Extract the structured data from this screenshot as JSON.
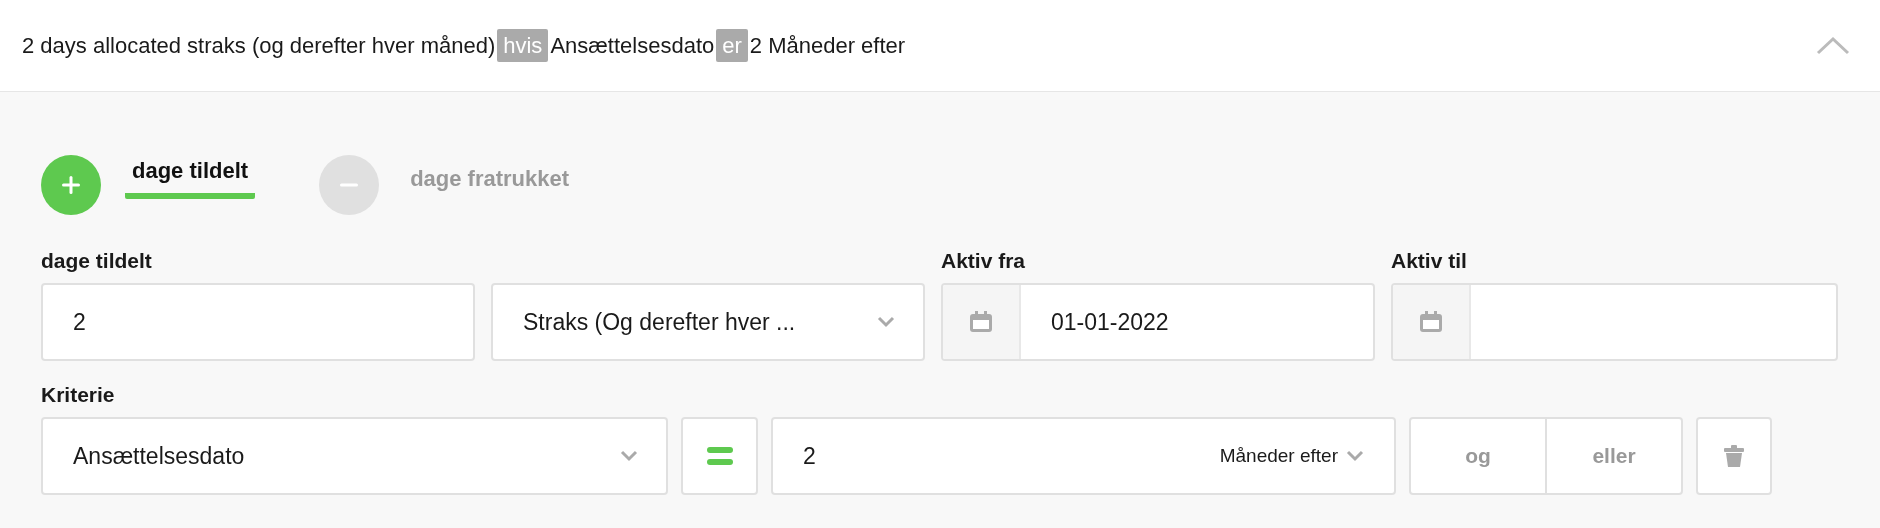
{
  "header": {
    "segments": [
      {
        "kind": "text",
        "text": "2 days allocated straks (og derefter hver måned)"
      },
      {
        "kind": "tag",
        "text": "hvis"
      },
      {
        "kind": "text",
        "text": "Ansættelsesdato"
      },
      {
        "kind": "tag",
        "text": "er"
      },
      {
        "kind": "text",
        "text": "2 Måneder efter"
      }
    ],
    "expanded": true
  },
  "mode_toggle": [
    {
      "kind": "add",
      "label": "dage tildelt",
      "selected": true
    },
    {
      "kind": "subtract",
      "label": "dage fratrukket",
      "selected": false
    }
  ],
  "fields": {
    "amount": {
      "label": "dage tildelt",
      "value": "2"
    },
    "frequency": {
      "value": "Straks (Og derefter hver ..."
    },
    "active_from": {
      "label": "Aktiv fra",
      "value": "01-01-2022"
    },
    "active_to": {
      "label": "Aktiv til"
    }
  },
  "criteria": {
    "label": "Kriterie",
    "attribute": "Ansættelsesdato",
    "value": "2",
    "unit": "Måneder efter",
    "logic_buttons": [
      "og",
      "eller"
    ]
  }
}
